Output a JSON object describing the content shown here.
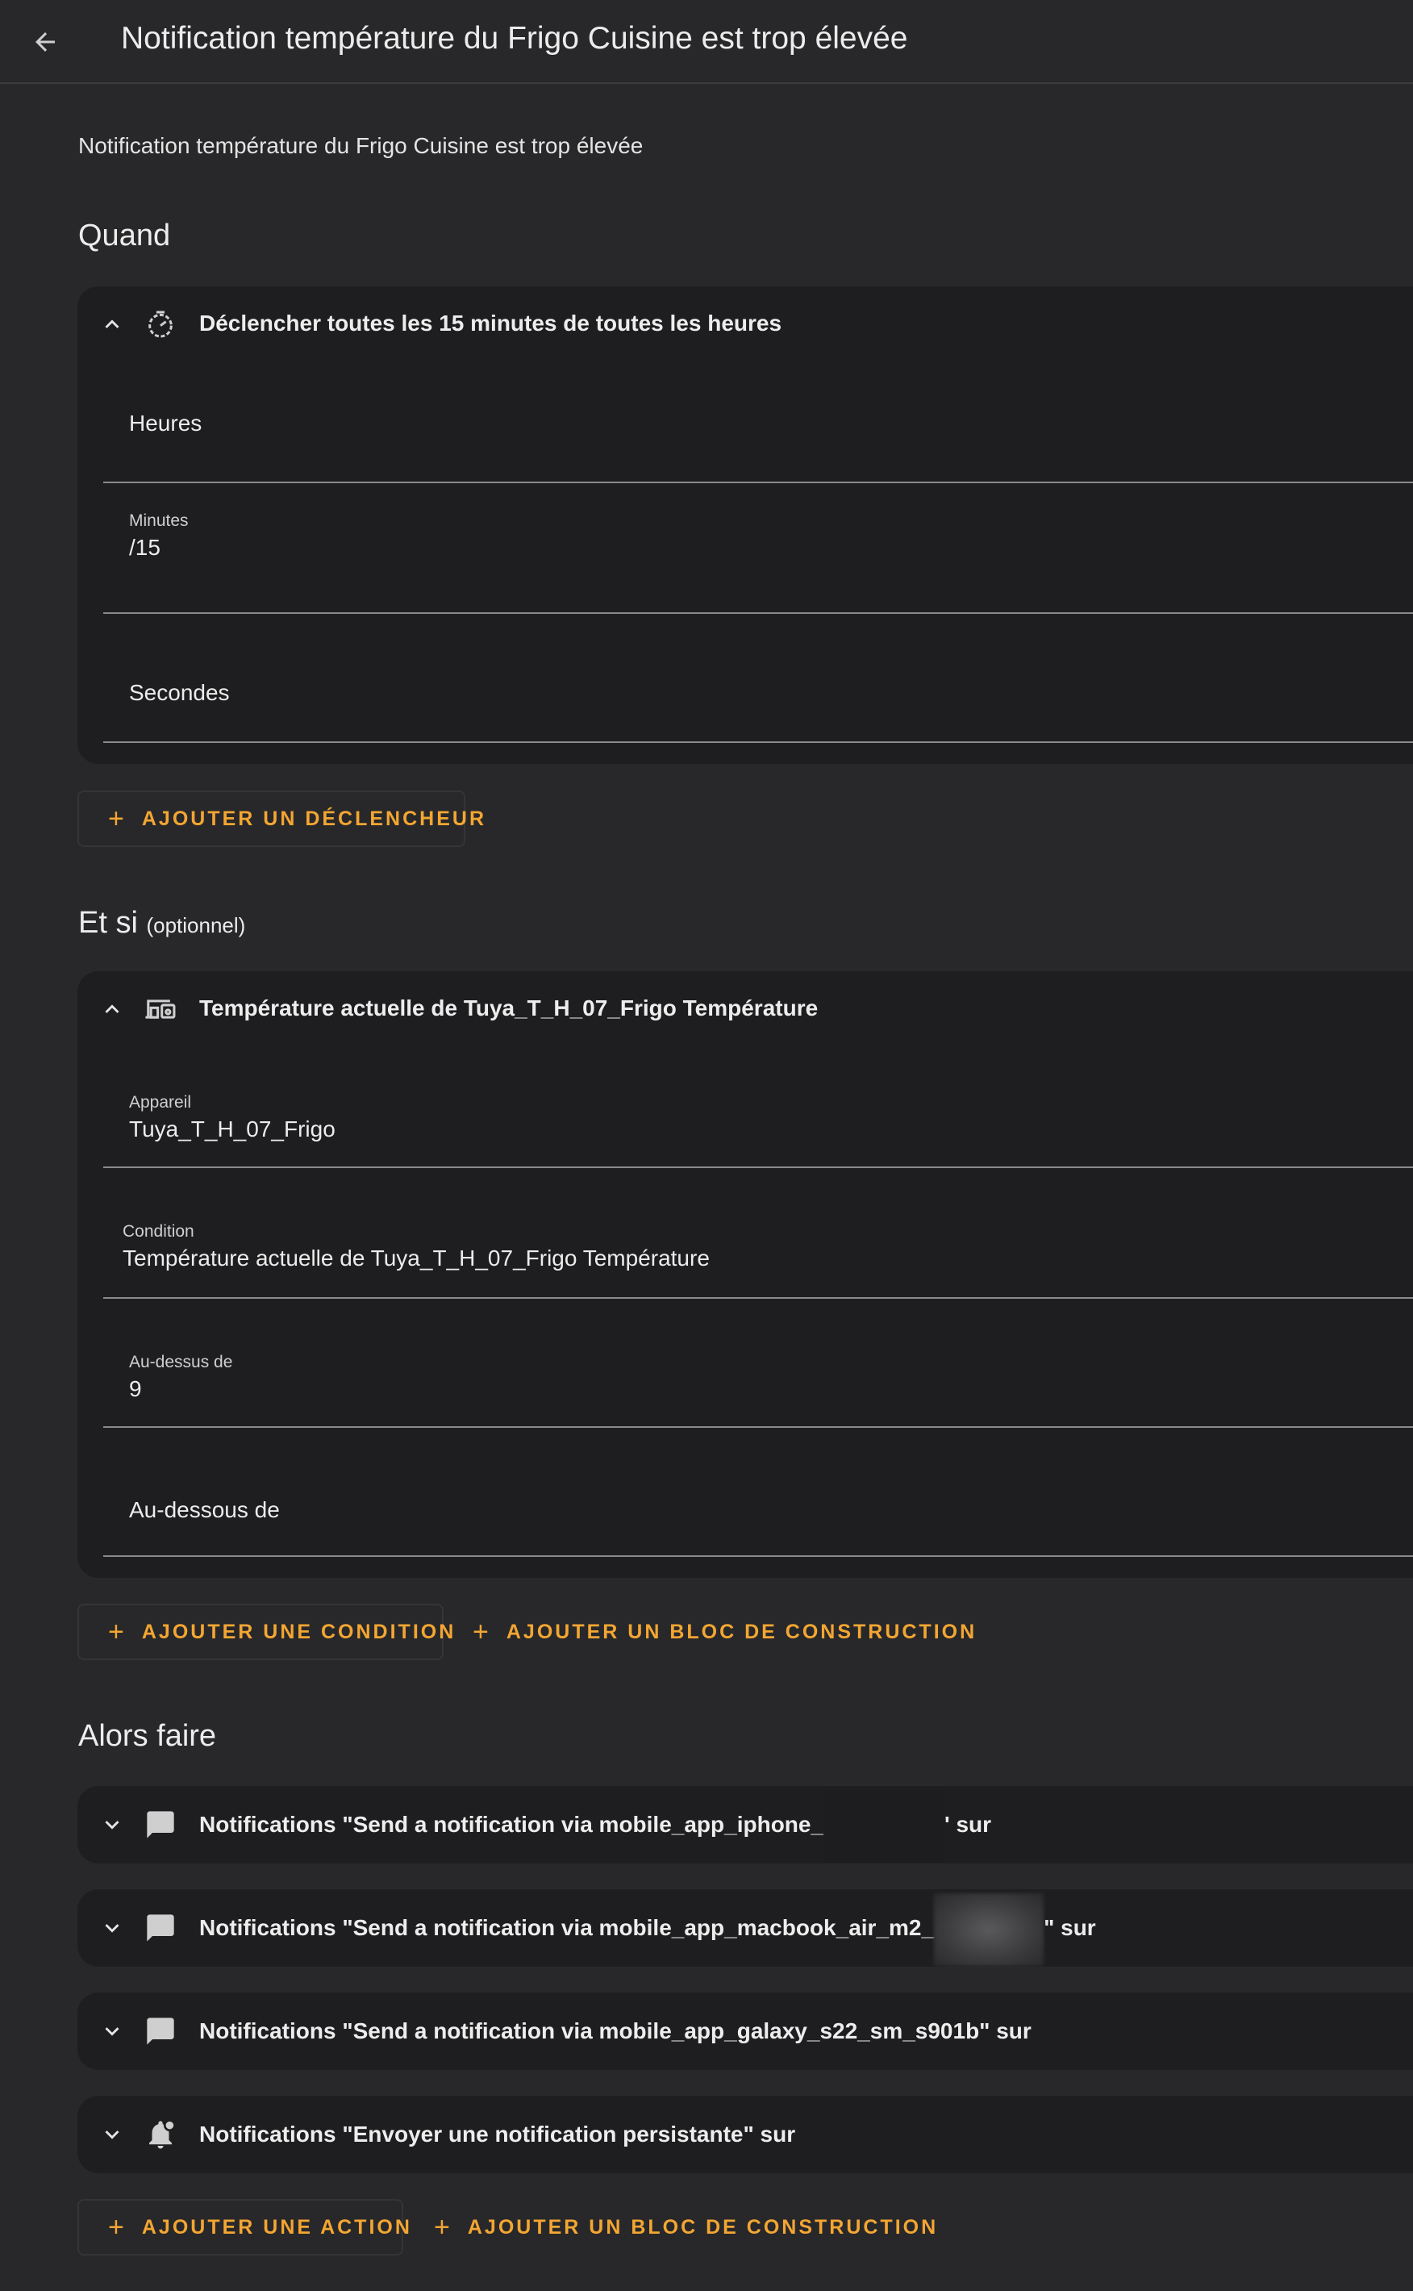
{
  "header": {
    "title": "Notification température du Frigo Cuisine est trop élevée",
    "back_icon": "arrow-left-icon"
  },
  "description": "Notification température du Frigo Cuisine est trop élevée",
  "when": {
    "title": "Quand",
    "trigger": {
      "text": "Déclencher toutes les 15 minutes de toutes les heures",
      "icon": "timer-clock-icon",
      "fields": {
        "hours_label": "Heures",
        "minutes_label": "Minutes",
        "minutes_value": "/15",
        "seconds_label": "Secondes"
      }
    },
    "add_label": "AJOUTER UN DÉCLENCHEUR"
  },
  "and_if": {
    "title": "Et si",
    "optional": "(optionnel)",
    "condition": {
      "text": "Température actuelle de Tuya_T_H_07_Frigo Température",
      "icon": "devices-icon",
      "fields": {
        "device_label": "Appareil",
        "device_value": "Tuya_T_H_07_Frigo",
        "condition_label": "Condition",
        "condition_value": "Température actuelle de Tuya_T_H_07_Frigo Température",
        "above_label": "Au-dessus de",
        "above_value": "9",
        "below_label": "Au-dessous de"
      }
    },
    "add_condition_label": "AJOUTER UNE CONDITION",
    "add_block_label": "AJOUTER UN BLOC DE CONSTRUCTION"
  },
  "then_do": {
    "title": "Alors faire",
    "actions": [
      {
        "prefix": "Notifications \"Send a notification via mobile_app_iphone_",
        "suffix": "' sur",
        "icon": "message-icon"
      },
      {
        "prefix": "Notifications \"Send a notification via mobile_app_macbook_air_m2_",
        "suffix": "\" sur",
        "icon": "message-icon"
      },
      {
        "text": "Notifications \"Send a notification via mobile_app_galaxy_s22_sm_s901b\" sur",
        "icon": "message-icon"
      },
      {
        "text": "Notifications \"Envoyer une notification persistante\" sur",
        "icon": "bell-badge-icon"
      }
    ],
    "add_action_label": "AJOUTER UNE ACTION",
    "add_block_label": "AJOUTER UN BLOC DE CONSTRUCTION"
  },
  "colors": {
    "accent": "#f3a632",
    "background": "#28282a",
    "card": "#1e1e20"
  }
}
